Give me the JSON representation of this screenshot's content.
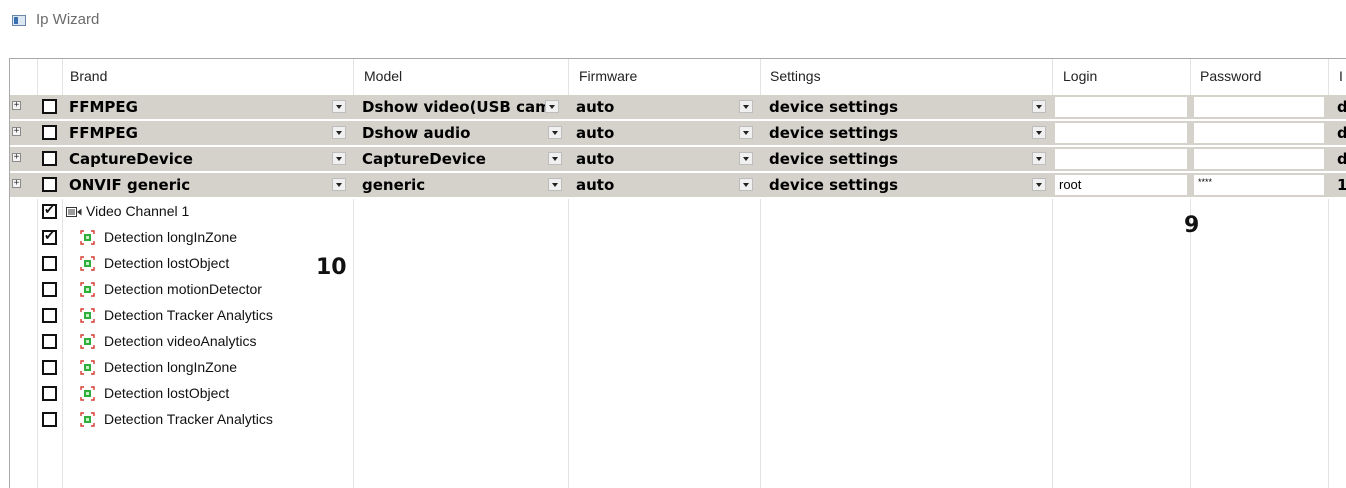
{
  "window": {
    "title": "Ip Wizard",
    "icon": "window-icon"
  },
  "columns": [
    "Brand",
    "Model",
    "Firmware",
    "Settings",
    "Login",
    "Password",
    "I"
  ],
  "rows": [
    {
      "brand": "FFMPEG",
      "model": "Dshow video(USB cam",
      "firmware": "auto",
      "settings": "device settings",
      "login": "",
      "password": "",
      "ip": "d"
    },
    {
      "brand": "FFMPEG",
      "model": "Dshow audio",
      "firmware": "auto",
      "settings": "device settings",
      "login": "",
      "password": "",
      "ip": "d"
    },
    {
      "brand": "CaptureDevice",
      "model": "CaptureDevice",
      "firmware": "auto",
      "settings": "device settings",
      "login": "",
      "password": "",
      "ip": "d"
    },
    {
      "brand": "ONVIF generic",
      "model": "generic",
      "firmware": "auto",
      "settings": "device settings",
      "login": "root",
      "password": "****",
      "ip": "1"
    }
  ],
  "children": [
    {
      "label": "Video Channel 1",
      "checked": true,
      "icon": "video-camera-icon"
    },
    {
      "label": "Detection longInZone",
      "checked": true,
      "icon": "detection-icon"
    },
    {
      "label": "Detection lostObject",
      "checked": false,
      "icon": "detection-icon"
    },
    {
      "label": "Detection motionDetector",
      "checked": false,
      "icon": "detection-icon"
    },
    {
      "label": "Detection Tracker Analytics",
      "checked": false,
      "icon": "detection-icon"
    },
    {
      "label": "Detection videoAnalytics",
      "checked": false,
      "icon": "detection-icon"
    },
    {
      "label": "Detection longInZone",
      "checked": false,
      "icon": "detection-icon"
    },
    {
      "label": "Detection lostObject",
      "checked": false,
      "icon": "detection-icon"
    },
    {
      "label": "Detection Tracker Analytics",
      "checked": false,
      "icon": "detection-icon"
    }
  ],
  "callouts": {
    "nine": "9",
    "ten": "10"
  },
  "colors": {
    "row_bg": "#d5d2cc",
    "grid_border": "#a9a9a9",
    "detection_icon": "#2fae3a",
    "detection_corners": "#d63a2f"
  }
}
